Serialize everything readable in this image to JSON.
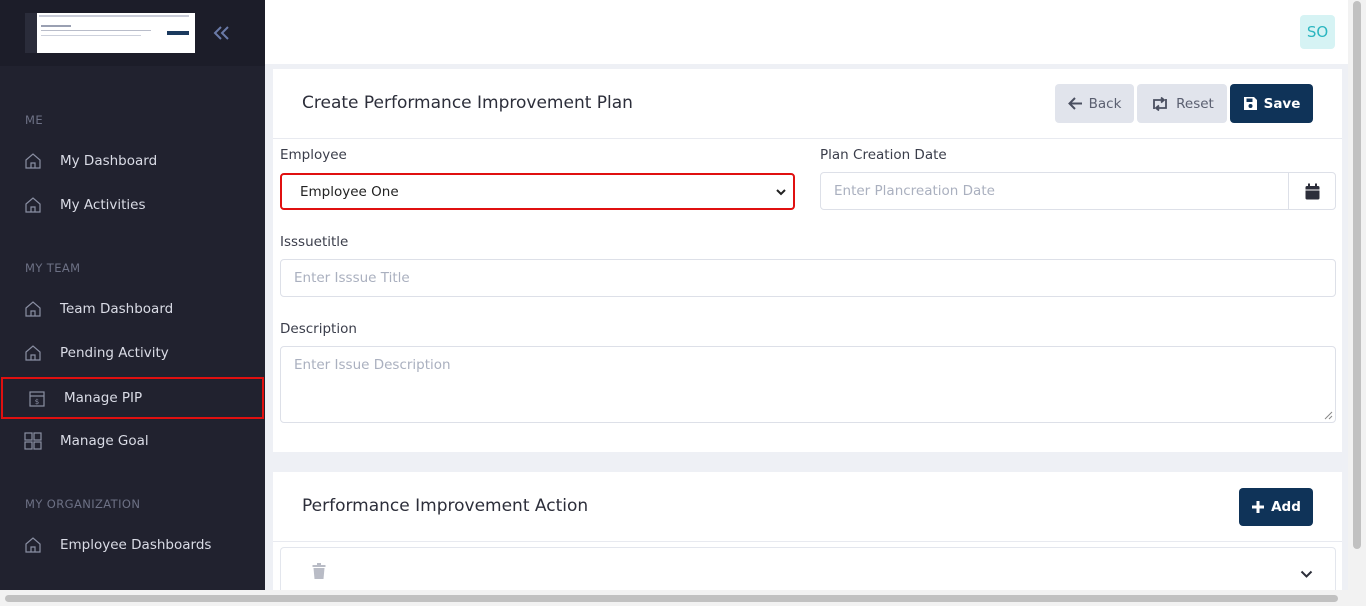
{
  "sidebar": {
    "collapse_icon": "double-chevron-left-icon",
    "sections": {
      "me": "ME",
      "my_team": "MY TEAM",
      "my_organization": "MY ORGANIZATION"
    },
    "items": [
      {
        "label": "My Dashboard",
        "icon": "home-icon"
      },
      {
        "label": "My Activities",
        "icon": "home-icon"
      },
      {
        "label": "Team Dashboard",
        "icon": "home-icon"
      },
      {
        "label": "Pending Activity",
        "icon": "home-icon"
      },
      {
        "label": "Manage PIP",
        "icon": "document-dollar-icon",
        "active": true
      },
      {
        "label": "Manage Goal",
        "icon": "grid-icon"
      },
      {
        "label": "Employee Dashboards",
        "icon": "home-icon"
      }
    ]
  },
  "header": {
    "avatar_initials": "SO"
  },
  "form": {
    "title": "Create Performance Improvement Plan",
    "back_label": "Back",
    "reset_label": "Reset",
    "save_label": "Save",
    "employee_label": "Employee",
    "employee_value": "Employee One",
    "plan_date_label": "Plan Creation Date",
    "plan_date_placeholder": "Enter Plancreation Date",
    "issue_title_label": "Isssuetitle",
    "issue_title_placeholder": "Enter Isssue Title",
    "description_label": "Description",
    "description_placeholder": "Enter Issue Description"
  },
  "actions": {
    "title": "Performance Improvement Action",
    "add_label": "Add"
  },
  "colors": {
    "sidebar_bg": "#21222f",
    "primary": "#0f3358",
    "highlight": "#e01010",
    "avatar_bg": "#d6f3f4",
    "avatar_text": "#2bb6c0"
  }
}
